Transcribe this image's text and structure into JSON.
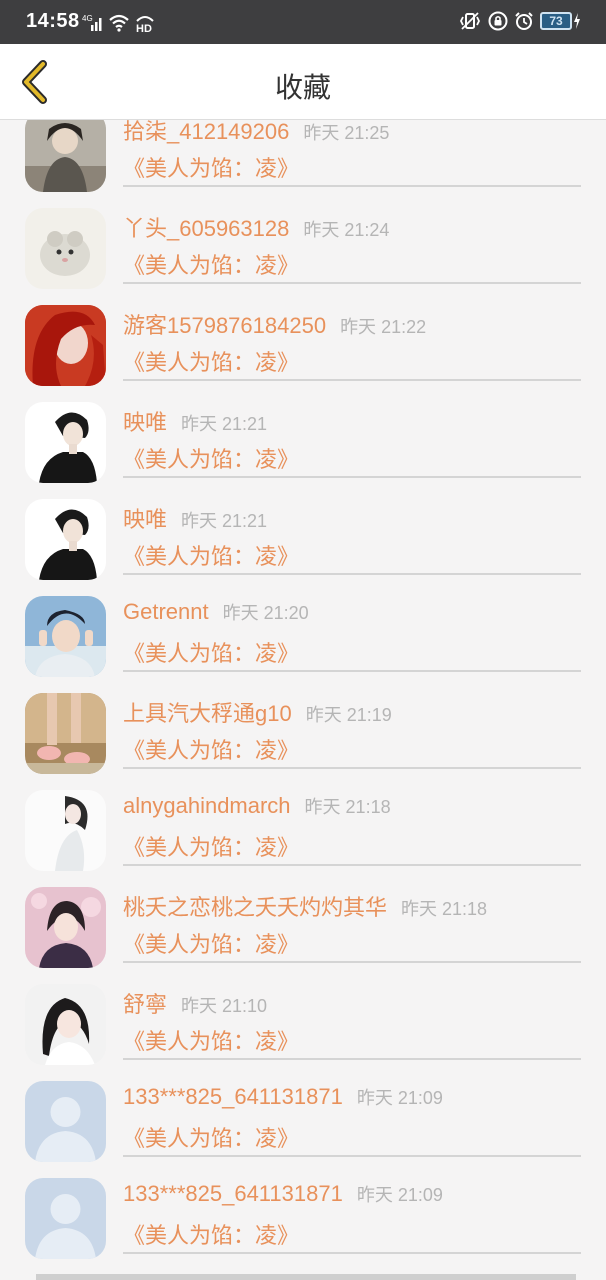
{
  "status_bar": {
    "time": "14:58",
    "network": "4G",
    "hd": "HD",
    "battery": "73"
  },
  "header": {
    "title": "收藏",
    "back_icon": "chevron-left-icon"
  },
  "colors": {
    "accent": "#e8915b",
    "back_arrow": "#e2b92a",
    "timestamp": "#b5b5b5"
  },
  "items": [
    {
      "name": "拾柒_412149206",
      "time": "昨天 21:25",
      "book": "《美人为馅：凌》"
    },
    {
      "name": "丫头_605963128",
      "time": "昨天 21:24",
      "book": "《美人为馅：凌》"
    },
    {
      "name": "游客1579876184250",
      "time": "昨天 21:22",
      "book": "《美人为馅：凌》"
    },
    {
      "name": "映唯",
      "time": "昨天 21:21",
      "book": "《美人为馅：凌》"
    },
    {
      "name": "映唯",
      "time": "昨天 21:21",
      "book": "《美人为馅：凌》"
    },
    {
      "name": "Getrennt",
      "time": "昨天 21:20",
      "book": "《美人为馅：凌》"
    },
    {
      "name": "上具汽大稃通g10",
      "time": "昨天 21:19",
      "book": "《美人为馅：凌》"
    },
    {
      "name": "alnygahindmarch",
      "time": "昨天 21:18",
      "book": "《美人为馅：凌》"
    },
    {
      "name": "桃夭之恋桃之夭夭灼灼其华",
      "time": "昨天 21:18",
      "book": "《美人为馅：凌》"
    },
    {
      "name": "舒寧",
      "time": "昨天 21:10",
      "book": "《美人为馅：凌》"
    },
    {
      "name": "133***825_641131871",
      "time": "昨天 21:09",
      "book": "《美人为馅：凌》"
    },
    {
      "name": "133***825_641131871",
      "time": "昨天 21:09",
      "book": "《美人为馅：凌》"
    }
  ]
}
